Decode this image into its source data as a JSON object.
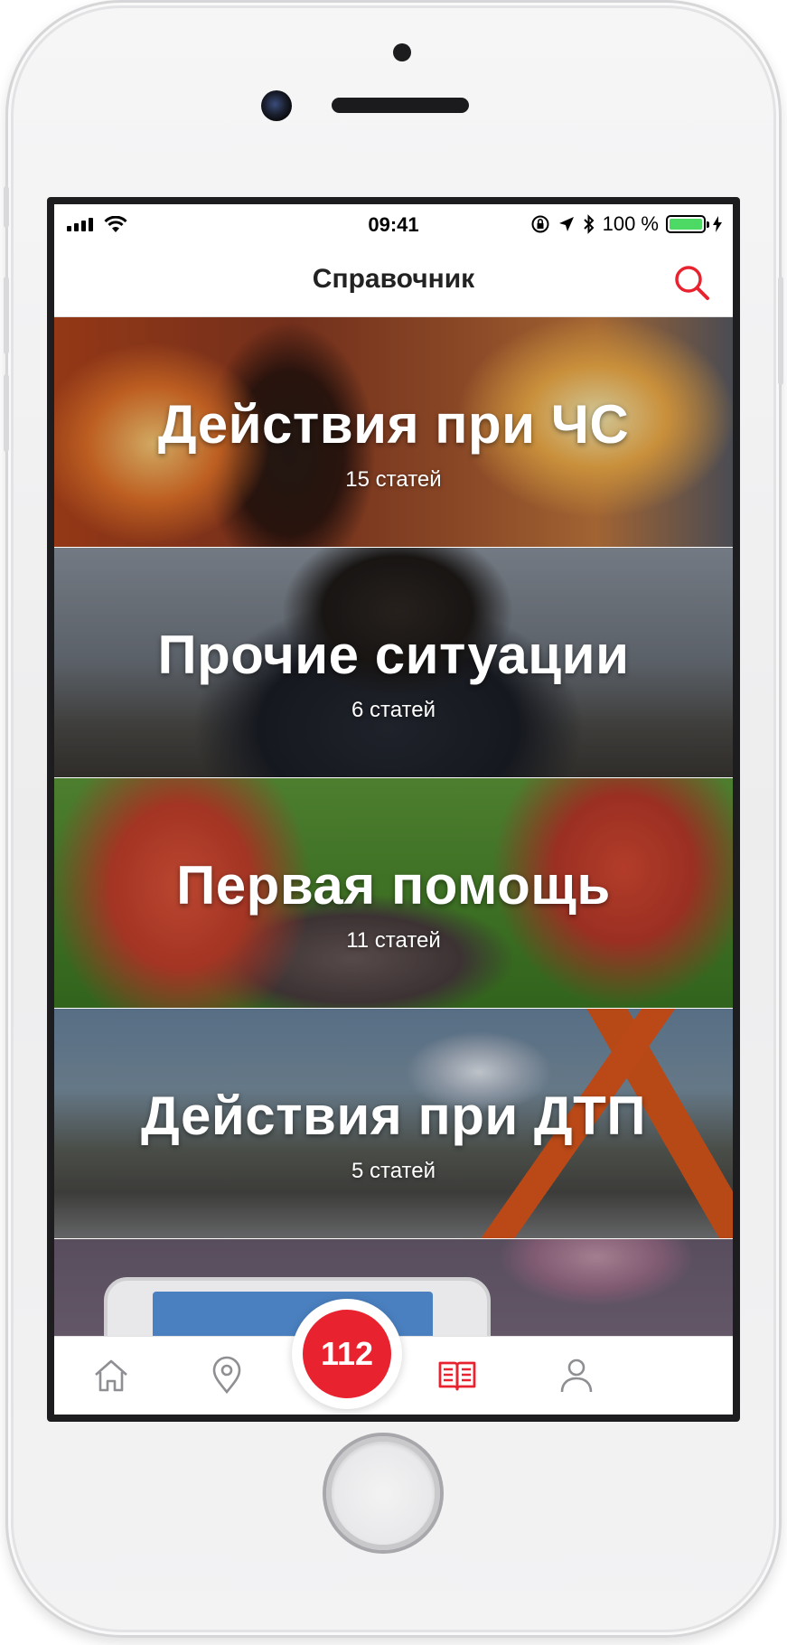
{
  "status_bar": {
    "time": "09:41",
    "battery_percent": "100 %",
    "battery_level": 1.0
  },
  "header": {
    "title": "Справочник"
  },
  "categories": [
    {
      "title": "Действия при ЧС",
      "count": "15 статей"
    },
    {
      "title": "Прочие ситуации",
      "count": "6 статей"
    },
    {
      "title": "Первая помощь",
      "count": "11 статей"
    },
    {
      "title": "Действия при ДТП",
      "count": "5 статей"
    }
  ],
  "tab_bar": {
    "emergency_label": "112",
    "active_tab": "reference-book",
    "accent_color": "#e8232f",
    "icons": [
      "home-icon",
      "location-pin-icon",
      "book-icon",
      "user-icon"
    ]
  }
}
